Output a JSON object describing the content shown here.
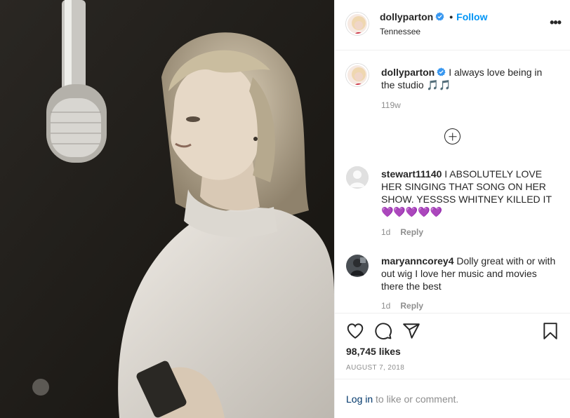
{
  "post": {
    "author": "dollyparton",
    "follow_label": "Follow",
    "separator": "•",
    "location": "Tennessee",
    "more_label": "•••"
  },
  "caption": {
    "username": "dollyparton",
    "text": "I always love being in the studio 🎵🎵",
    "time": "119w"
  },
  "comments": [
    {
      "username": "stewart11140",
      "text": "I ABSOLUTELY LOVE HER SINGING THAT SONG ON HER SHOW. YESSSS WHITNEY KILLED IT 💜💜💜💜💜",
      "time": "1d",
      "reply_label": "Reply"
    },
    {
      "username": "maryanncorey4",
      "text": "Dolly great with or with out wig I love her music and movies there the best",
      "time": "1d",
      "reply_label": "Reply"
    }
  ],
  "stats": {
    "likes": "98,745 likes",
    "date": "AUGUST 7, 2018"
  },
  "login": {
    "link": "Log in",
    "rest": " to like or comment."
  },
  "icons": {
    "verified": "verified-badge-icon",
    "like": "heart-icon",
    "comment": "comment-icon",
    "share": "share-icon",
    "save": "bookmark-icon",
    "load_more": "plus-circle-icon"
  },
  "colors": {
    "accent": "#0095f6",
    "link": "#00376b",
    "muted": "#8e8e8e",
    "text": "#262626"
  }
}
